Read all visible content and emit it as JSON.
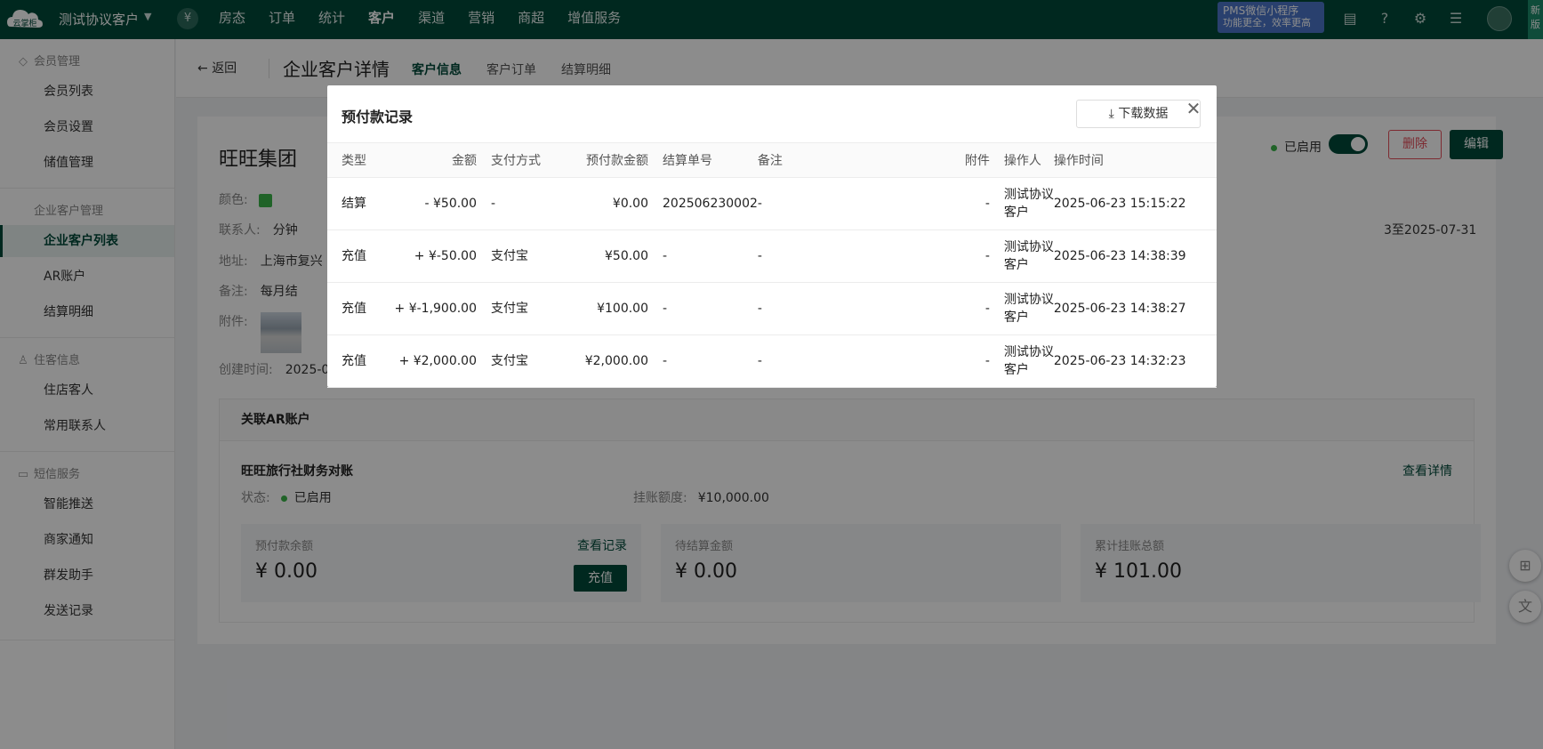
{
  "topbar": {
    "logo_text": "云掌柜",
    "app_title": "测试协议客户",
    "yen": "¥",
    "nav": [
      "房态",
      "订单",
      "统计",
      "客户",
      "渠道",
      "营销",
      "商超",
      "增值服务"
    ],
    "promo_line1": "PMS微信小程序",
    "promo_line2": "功能更全，效率更高",
    "new_tag": "新版"
  },
  "sidebar": {
    "groups": [
      {
        "title": "会员管理",
        "items": [
          "会员列表",
          "会员设置",
          "储值管理"
        ]
      },
      {
        "title": "企业客户管理",
        "items": [
          "企业客户列表",
          "AR账户",
          "结算明细"
        ]
      },
      {
        "title": "住客信息",
        "items": [
          "住店客人",
          "常用联系人"
        ]
      },
      {
        "title": "短信服务",
        "items": [
          "智能推送",
          "商家通知",
          "群发助手",
          "发送记录"
        ]
      }
    ]
  },
  "header": {
    "back_label": "返回",
    "page_title": "企业客户详情",
    "tabs": [
      "客户信息",
      "客户订单",
      "结算明细"
    ]
  },
  "customer": {
    "name": "旺旺集团",
    "color_label": "颜色:",
    "contact_label": "联系人:",
    "contact_value": "分钟",
    "address_label": "地址:",
    "address_value": "上海市复兴",
    "note_label": "备注:",
    "note_value": "每月结",
    "attachment_label": "附件:",
    "created_label": "创建时间:",
    "created_value": "2025-0",
    "date_right": "3至2025-07-31",
    "status": "已启用",
    "delete_label": "删除",
    "edit_label": "编辑"
  },
  "ar": {
    "title": "关联AR账户",
    "account_name": "旺旺旅行社财务对账",
    "detail_link": "查看详情",
    "status_label": "状态:",
    "status_value": "已启用",
    "limit_label": "挂账额度:",
    "limit_value": "¥10,000.00",
    "boxes": [
      {
        "label": "预付款余额",
        "value": "¥ 0.00",
        "link": "查看记录",
        "button": "充值"
      },
      {
        "label": "待结算金额",
        "value": "¥ 0.00"
      },
      {
        "label": "累计挂账总额",
        "value": "¥ 101.00"
      }
    ]
  },
  "modal": {
    "title": "预付款记录",
    "download_label": "下载数据",
    "columns": [
      "类型",
      "金额",
      "支付方式",
      "预付款金额",
      "结算单号",
      "备注",
      "附件",
      "操作人",
      "操作时间"
    ],
    "rows": [
      [
        "结算",
        "- ¥50.00",
        "-",
        "¥0.00",
        "202506230002",
        "-",
        "-",
        "测试协议客户",
        "2025-06-23 15:15:22"
      ],
      [
        "充值",
        "+ ¥-50.00",
        "支付宝",
        "¥50.00",
        "-",
        "-",
        "-",
        "测试协议客户",
        "2025-06-23 14:38:39"
      ],
      [
        "充值",
        "+ ¥-1,900.00",
        "支付宝",
        "¥100.00",
        "-",
        "-",
        "-",
        "测试协议客户",
        "2025-06-23 14:38:27"
      ],
      [
        "充值",
        "+ ¥2,000.00",
        "支付宝",
        "¥2,000.00",
        "-",
        "-",
        "-",
        "测试协议客户",
        "2025-06-23 14:32:23"
      ]
    ]
  },
  "icons": {
    "accent_color": "#004a3a",
    "status_color": "#3bb44a",
    "danger_color": "#e34d59"
  }
}
